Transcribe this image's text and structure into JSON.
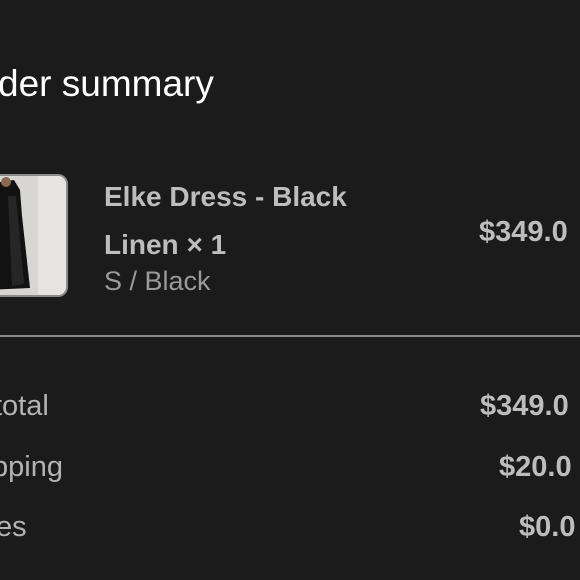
{
  "header": {
    "title": "der summary"
  },
  "item": {
    "name": "Elke Dress - Black Linen × 1",
    "variant": "S / Black",
    "price": "$349.0",
    "thumbnail_icon": "dress-product-image"
  },
  "summary": {
    "rows": [
      {
        "label": "total",
        "value": "$349.0"
      },
      {
        "label": "pping",
        "value": "$20.0"
      },
      {
        "label": "es",
        "value": "$0.0"
      }
    ]
  },
  "colors": {
    "background": "#1c1b1c",
    "text_primary": "#ffffff",
    "text_secondary": "#bdbdbd",
    "text_muted": "#9a9a9a",
    "divider": "#8a8a8a"
  }
}
